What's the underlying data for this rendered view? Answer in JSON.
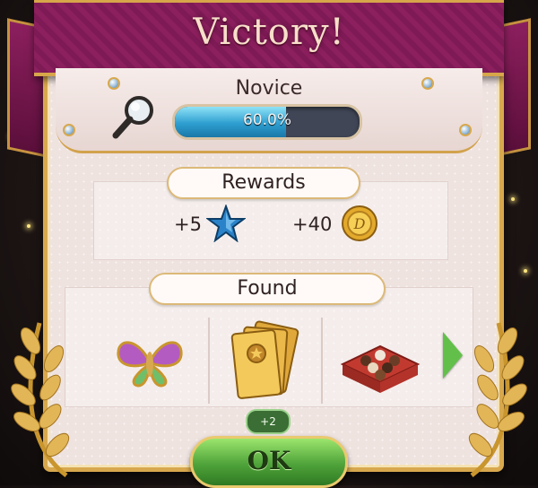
{
  "dialog": {
    "title": "Victory!",
    "level": {
      "name": "Novice",
      "progress_fraction": 0.6,
      "progress_text": "60.0%"
    },
    "rewards": {
      "header": "Rewards",
      "star_amount": "+5",
      "coin_amount": "+40"
    },
    "found": {
      "header": "Found",
      "items": [
        "butterfly-brooch",
        "golden-tickets",
        "box-of-chocolates"
      ],
      "ticket_badge": "+2"
    },
    "ok_label": "OK"
  },
  "colors": {
    "banner": "#8c1f5e",
    "gold_border": "#d8a84e",
    "progress_fill": "#2d9ed0",
    "ok_button": "#4fa33a"
  },
  "icons": [
    "magnifier-icon",
    "blue-star-icon",
    "gold-coin-icon",
    "next-arrow-icon",
    "laurel-icon"
  ]
}
